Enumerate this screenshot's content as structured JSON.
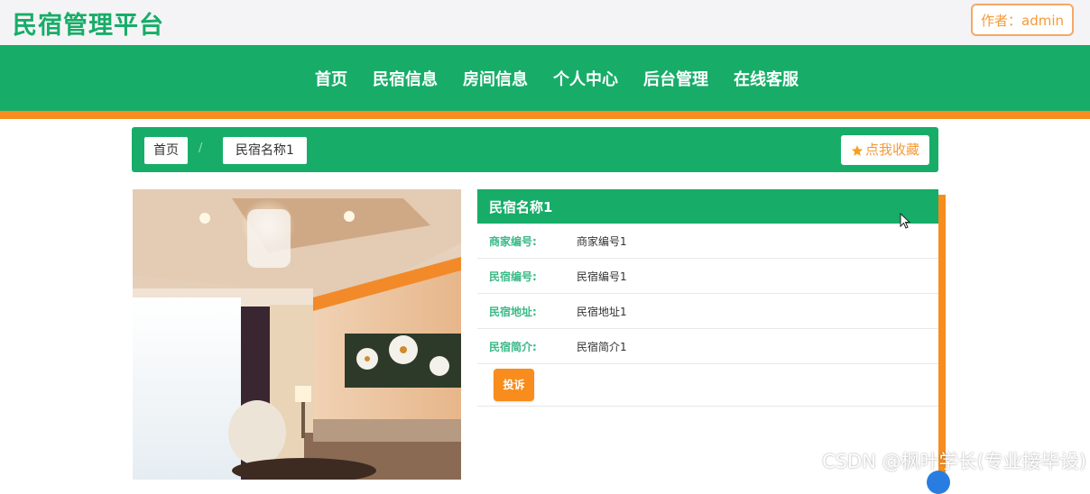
{
  "header": {
    "brand": "民宿管理平台",
    "author_label": "作者：admin"
  },
  "nav": {
    "items": [
      "首页",
      "民宿信息",
      "房间信息",
      "个人中心",
      "后台管理",
      "在线客服"
    ]
  },
  "breadcrumb": {
    "home": "首页",
    "separator": "/",
    "current": "民宿名称1",
    "favorite_label": "点我收藏"
  },
  "detail": {
    "title": "民宿名称1",
    "rows": [
      {
        "label": "商家编号:",
        "value": "商家编号1"
      },
      {
        "label": "民宿编号:",
        "value": "民宿编号1"
      },
      {
        "label": "民宿地址:",
        "value": "民宿地址1"
      },
      {
        "label": "民宿简介:",
        "value": "民宿简介1"
      }
    ],
    "complain_label": "投诉"
  },
  "watermark": "CSDN @枫叶学长(专业接毕设)",
  "colors": {
    "primary": "#17ad68",
    "accent": "#f88c1c",
    "author_border": "#f6a766"
  },
  "icons": {
    "favorite": "star-icon",
    "pointer": "cursor-icon"
  }
}
